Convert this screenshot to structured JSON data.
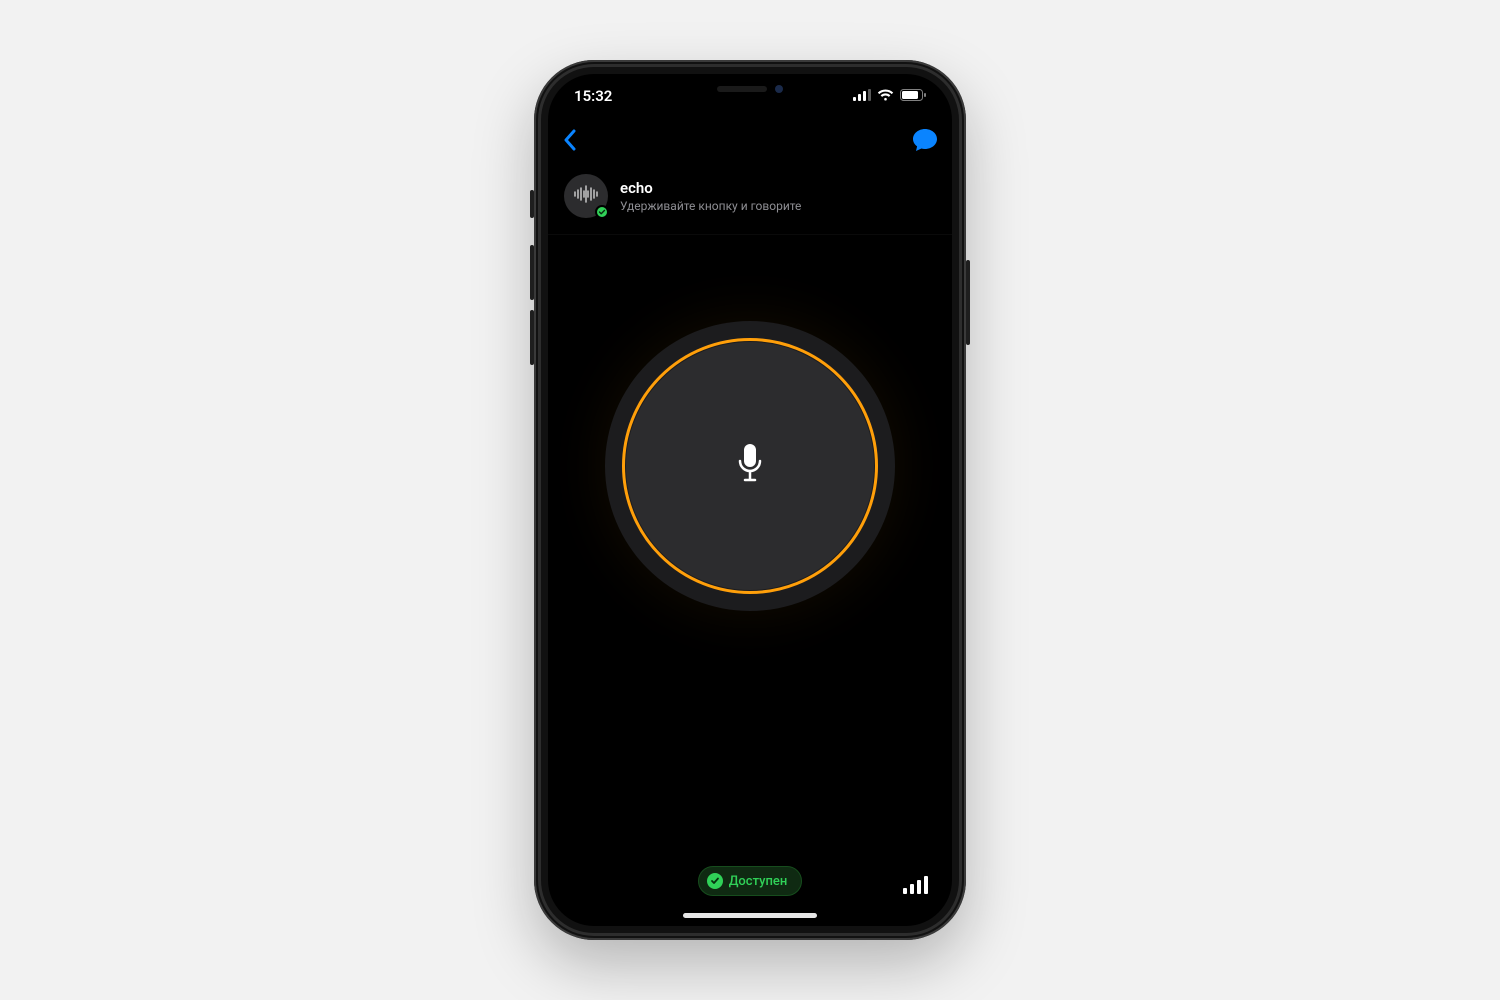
{
  "status_bar": {
    "time": "15:32"
  },
  "contact": {
    "name": "echo",
    "subtitle": "Удерживайте кнопку и говорите"
  },
  "availability": {
    "label": "Доступен"
  },
  "colors": {
    "accent_orange": "#ff9f0a",
    "accent_blue": "#0a84ff",
    "accent_green": "#30d158"
  }
}
